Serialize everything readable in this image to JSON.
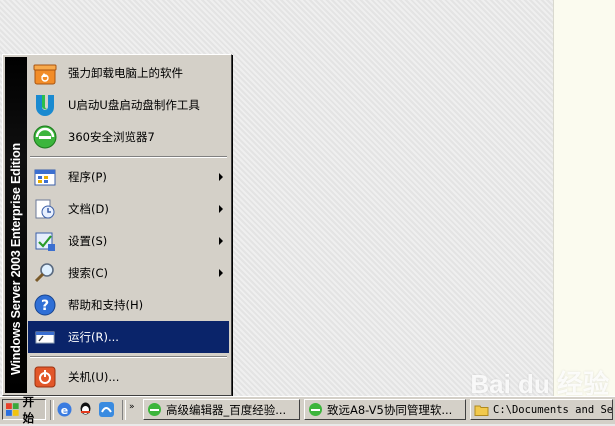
{
  "start_menu": {
    "side_banner": "Windows Server 2003 Enterprise Edition",
    "pinned": [
      {
        "label": "强力卸载电脑上的软件",
        "icon": "recycle-box-icon"
      },
      {
        "label": "U启动U盘启动盘制作工具",
        "icon": "u-logo-icon"
      },
      {
        "label": "360安全浏览器7",
        "icon": "browser-360-icon"
      }
    ],
    "items": [
      {
        "label": "程序(P)",
        "icon": "programs-icon",
        "submenu": true
      },
      {
        "label": "文档(D)",
        "icon": "documents-icon",
        "submenu": true
      },
      {
        "label": "设置(S)",
        "icon": "settings-icon",
        "submenu": true
      },
      {
        "label": "搜索(C)",
        "icon": "search-icon",
        "submenu": true
      },
      {
        "label": "帮助和支持(H)",
        "icon": "help-icon",
        "submenu": false
      },
      {
        "label": "运行(R)...",
        "icon": "run-icon",
        "submenu": false,
        "selected": true
      }
    ],
    "shutdown": {
      "label": "关机(U)...",
      "icon": "shutdown-icon"
    },
    "selected_color": "#0a246a"
  },
  "taskbar": {
    "start_label": "开始",
    "quicklaunch": [
      "ie-icon",
      "qq-icon",
      "browser-icon"
    ],
    "tasks": [
      {
        "label": "高级编辑器_百度经验...",
        "icon": "browser-360-icon"
      },
      {
        "label": "致远A8-V5协同管理软...",
        "icon": "browser-360-icon"
      },
      {
        "label": "C:\\Documents and Se...",
        "icon": "folder-icon"
      }
    ]
  },
  "watermark": "Bai du 经验"
}
